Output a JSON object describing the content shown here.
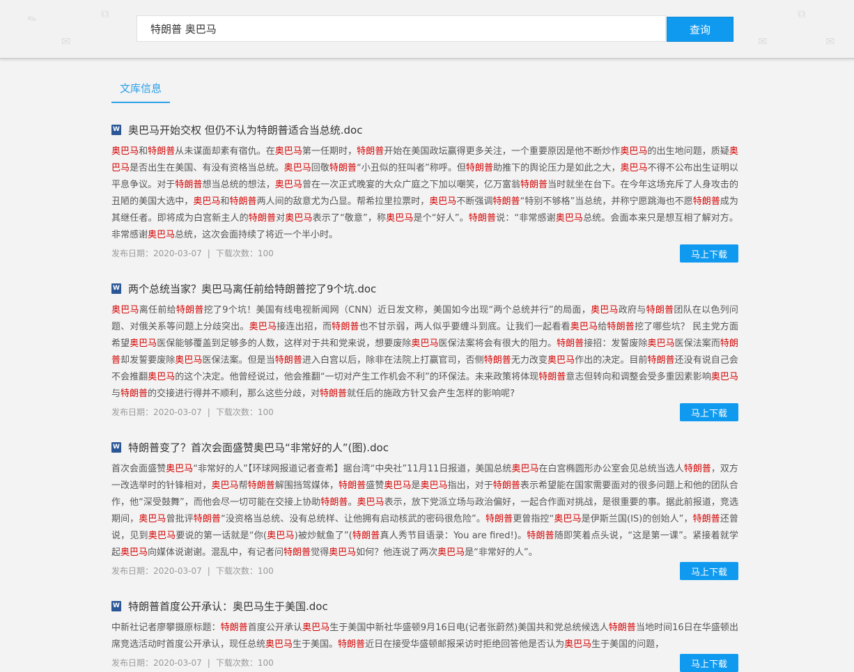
{
  "search": {
    "query": "特朗普 奥巴马",
    "button_label": "查询"
  },
  "tabs": [
    {
      "label": "文库信息"
    }
  ],
  "keywords": [
    "奥巴马",
    "特朗普"
  ],
  "download_label": "马上下载",
  "meta_labels": {
    "date": "发布日期：",
    "count": "下载次数：",
    "sep": "|"
  },
  "colors": {
    "accent": "#0f9af0",
    "highlight": "#d40000",
    "doc_icon": "#2b5797"
  },
  "icons": {
    "doc": "word-doc-icon"
  },
  "results": [
    {
      "title": "奥巴马开始交权 但仍不认为特朗普适合当总统.doc",
      "summary": "奥巴马和特朗普从未谋面却素有宿仇。在奥巴马第一任期时，特朗普开始在美国政坛赢得更多关注，一个重要原因是他不断炒作奥巴马的出生地问题，质疑奥巴马是否出生在美国、有没有资格当总统。奥巴马回敬特朗普“小丑似的狂叫者”称呼。但特朗普助推下的舆论压力是如此之大，奥巴马不得不公布出生证明以平息争议。对于特朗普想当总统的想法，奥巴马曾在一次正式晚宴的大众广庭之下加以嘲笑，亿万富翁特朗普当时就坐在台下。在今年这场充斥了人身攻击的丑陋的美国大选中，奥巴马和特朗普两人间的敌意尤为凸显。帮希拉里拉票时，奥巴马不断强调特朗普“特别不够格”当总统，并称宁愿跳海也不愿特朗普成为其继任者。即将成为白宫新主人的特朗普对奥巴马表示了“敬意”，称奥巴马是个“好人”。特朗普说：“非常感谢奥巴马总统。会面本来只是想互相了解对方。非常感谢奥巴马总统，这次会面持续了将近一个半小时。",
      "date": "2020-03-07",
      "downloads": "100"
    },
    {
      "title": "两个总统当家？奥巴马离任前给特朗普挖了9个坑.doc",
      "summary": "奥巴马离任前给特朗普挖了9个坑！美国有线电视新闻网（CNN）近日发文称，美国如今出现“两个总统并行”的局面，奥巴马政府与特朗普团队在以色列问题、对俄关系等问题上分歧突出。奥巴马接连出招，而特朗普也不甘示弱，两人似乎要缠斗到底。让我们一起看看奥巴马给特朗普挖了哪些坑？ 民主党方面希望奥巴马医保能够覆盖到足够多的人数，这样对于共和党来说，想要废除奥巴马医保法案将会有很大的阻力。特朗普接招：发誓废除奥巴马医保法案而特朗普却发誓要废除奥巴马医保法案。但是当特朗普进入白宫以后，除非在法院上打赢官司，否侧特朗普无力改变奥巴马作出的决定。目前特朗普还没有说自己会不会推翻奥巴马的这个决定。他曾经说过，他会推翻“一切对产生工作机会不利”的环保法。未来政策将体现特朗普意志但转向和调整会受多重因素影响奥巴马与特朗普的交接进行得并不顺利，那么这些分歧，对特朗普就任后的施政方针又会产生怎样的影响呢?",
      "date": "2020-03-07",
      "downloads": "100"
    },
    {
      "title": "特朗普变了？首次会面盛赞奥巴马“非常好的人”(图).doc",
      "summary": "首次会面盛赞奥巴马“非常好的人”【环球网报道记者查希】据台湾“中央社”11月11日报道，美国总统奥巴马在白宫椭圆形办公室会见总统当选人特朗普，双方一改选举时的针锋相对，奥巴马帮特朗普解围挡驾媒体，特朗普盛赞奥巴马是奥巴马指出，对于特朗普表示希望能在国家需要面对的很多问题上和他的团队合作，他“深受鼓舞”，而他会尽一切可能在交接上协助特朗普。奥巴马表示，放下党派立场与政治偏好，一起合作面对挑战，是很重要的事。据此前报道，竞选期间，奥巴马曾批评特朗普“没资格当总统、没有总统样、让他拥有启动核武的密码很危险”。特朗普更曾指控“奥巴马是伊斯兰国(IS)的创始人”，特朗普还曾说，见到奥巴马要说的第一话就是“你(奥巴马)被炒鱿鱼了”(特朗普真人秀节目语录：You are fired!)。特朗普随即笑着点头说，“这是第一课”。紧接着就学起奥巴马向媒体说谢谢。混乱中，有记者问特朗普觉得奥巴马如何？他连说了两次奥巴马是“非常好的人”。",
      "date": "2020-03-07",
      "downloads": "100"
    },
    {
      "title": "特朗普首度公开承认：奥巴马生于美国.doc",
      "summary": "中新社记者廖攀摄原标题：特朗普首度公开承认奥巴马生于美国中新社华盛顿9月16日电(记者张蔚然)美国共和党总统候选人特朗普当地时间16日在华盛顿出席竞选活动时首度公开承认，现任总统奥巴马生于美国。特朗普近日在接受华盛顿邮报采访时拒绝回答他是否认为奥巴马生于美国的问题，",
      "date": "2020-03-07",
      "downloads": "100"
    }
  ]
}
